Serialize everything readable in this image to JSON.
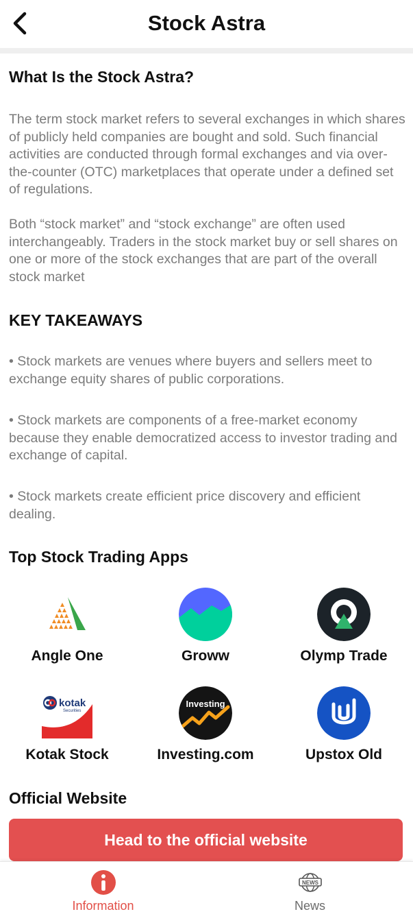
{
  "header": {
    "title": "Stock Astra"
  },
  "intro": {
    "heading": "What Is the Stock Astra?",
    "para1": "The term stock market refers to several exchanges in which shares of publicly held companies are bought and sold. Such financial activities are conducted through formal exchanges and via over-the-counter (OTC) marketplaces that operate under a defined set of regulations.",
    "para2": "Both “stock market” and “stock exchange” are often used interchangeably. Traders in the stock market buy or sell shares on one or more of the stock exchanges that are part of the overall stock market"
  },
  "takeaways": {
    "heading": "KEY TAKEAWAYS",
    "items": [
      "• Stock markets are venues where buyers and sellers meet to exchange equity shares of public corporations.",
      "• Stock markets are components of a free-market economy because they enable democratized access to investor trading and exchange of capital.",
      "• Stock markets create efficient price discovery and efficient dealing."
    ]
  },
  "apps": {
    "heading": "Top Stock Trading Apps",
    "items": [
      {
        "name": "Angle One",
        "icon": "angel-one-logo"
      },
      {
        "name": "Groww",
        "icon": "groww-logo"
      },
      {
        "name": "Olymp Trade",
        "icon": "olymp-trade-logo"
      },
      {
        "name": "Kotak Stock",
        "icon": "kotak-logo",
        "logo_text": "kotak",
        "logo_sub": "Securities"
      },
      {
        "name": "Investing.com",
        "icon": "investing-logo",
        "logo_text": "Investing"
      },
      {
        "name": "Upstox Old",
        "icon": "upstox-logo"
      }
    ]
  },
  "official": {
    "heading": "Official Website",
    "button_label": "Head to the official website"
  },
  "bottom_nav": {
    "items": [
      {
        "label": "Information",
        "icon": "info-icon",
        "active": true
      },
      {
        "label": "News",
        "icon": "news-icon",
        "active": false,
        "icon_text": "NEWS"
      }
    ]
  },
  "colors": {
    "accent": "#e35050",
    "active_tab": "#e24f47"
  }
}
